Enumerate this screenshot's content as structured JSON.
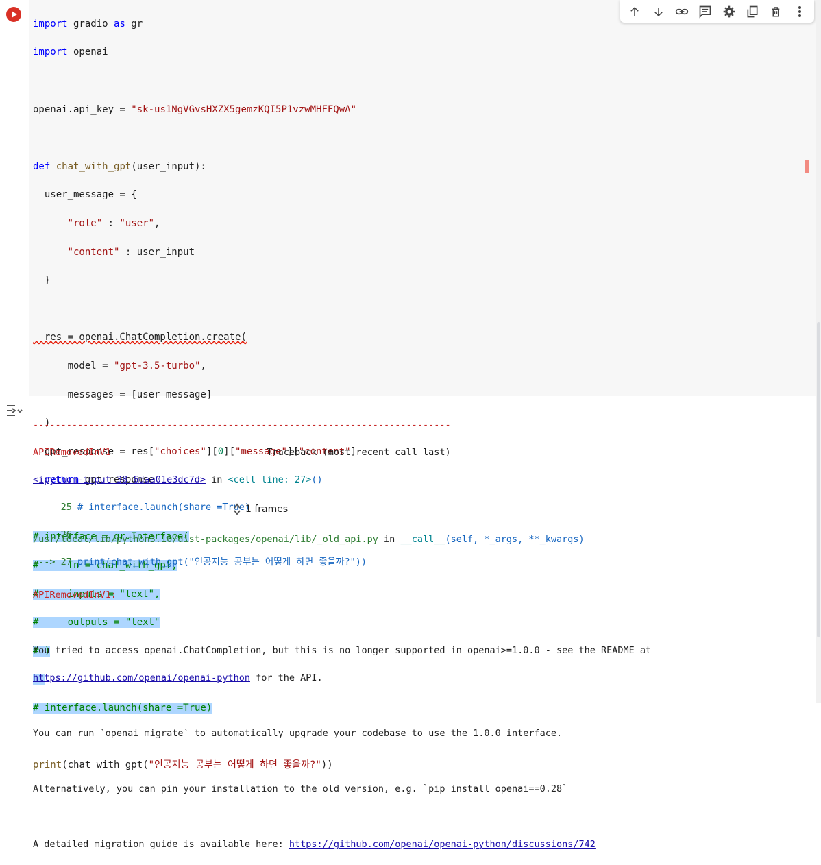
{
  "toolbar": {
    "icons": [
      "arrow-up-icon",
      "arrow-down-icon",
      "link-icon",
      "comment-icon",
      "gear-icon",
      "mirror-cell-icon",
      "trash-icon",
      "more-vert-icon"
    ]
  },
  "code": {
    "l1a": "import",
    "l1b": " gradio ",
    "l1c": "as",
    "l1d": " gr",
    "l2a": "import",
    "l2b": " openai",
    "l4a": "openai.api_key = ",
    "l4b": "\"sk-us1NgVGvsHXZX5gemzKQI5P1vzwMHFFQwA\"",
    "l6a": "def",
    "l6b": " chat_with_gpt",
    "l6c": "(user_input):",
    "l7": "  user_message = {",
    "l8a": "      ",
    "l8b": "\"role\"",
    "l8c": " : ",
    "l8d": "\"user\"",
    "l8e": ",",
    "l9a": "      ",
    "l9b": "\"content\"",
    "l9c": " : user_input",
    "l10": "  }",
    "l12a": "  res = openai.ChatCompletion.create(",
    "l13a": "      model = ",
    "l13b": "\"gpt-3.5-turbo\"",
    "l13c": ",",
    "l14": "      messages = [user_message]",
    "l15": "  )",
    "l16a": "  gpt_response = res[",
    "l16b": "\"choices\"",
    "l16c": "][",
    "l16d": "0",
    "l16e": "][",
    "l16f": "\"message\"",
    "l16g": "][",
    "l16h": "\"content\"",
    "l16i": "]",
    "l17a": "  ",
    "l17b": "return",
    "l17c": " gpt_response",
    "l19": "# interface = gr.Interface(",
    "l20": "#     fn = chat_with_gpt,",
    "l21": "#     inputs = \"text\",",
    "l22": "#     outputs = \"text\"",
    "l23": "# )",
    "l25": "# interface.launch(share =True)",
    "l27a": "print",
    "l27b": "(chat_with_gpt(",
    "l27c": "\"인공지능 공부는 어떻게 하면 좋을까?\"",
    "l27d": "))"
  },
  "output": {
    "dashes": "---------------------------------------------------------------------------",
    "err_name": "APIRemovedInV1",
    "traceback_header": "                            Traceback (most recent call last)",
    "input_link": "<ipython-input-38-6daa01e3dc7d>",
    "in_text": " in ",
    "cell_line": "<cell line: 27>",
    "cell_paren": "()",
    "t25": "     25 ",
    "t25code": "# interface.launch(share =True)",
    "t26": "     26",
    "t27arrow": "---> 27 ",
    "t27code": "print(chat_with_gpt(\"인공지능 공부는 어떻게 하면 좋을까?\"))",
    "frames": "1 frames",
    "lib_path": "/usr/local/lib/python3.10/dist-packages/openai/lib/_old_api.py",
    "lib_in": " in ",
    "lib_fn": "__call__",
    "lib_args": "(self, *_args, **_kwargs)",
    "err_name2": "APIRemovedInV1:",
    "msg1": "You tried to access openai.ChatCompletion, but this is no longer supported in openai>=1.0.0 - see the README at",
    "msg2_link": "https://github.com/openai/openai-python",
    "msg2_rest": " for the API.",
    "msg3": "You can run `openai migrate` to automatically upgrade your codebase to use the 1.0.0 interface.",
    "msg4": "Alternatively, you can pin your installation to the old version, e.g. `pip install openai==0.28`",
    "msg5": "A detailed migration guide is available here: ",
    "msg5_link": "https://github.com/openai/openai-python/discussions/742"
  }
}
